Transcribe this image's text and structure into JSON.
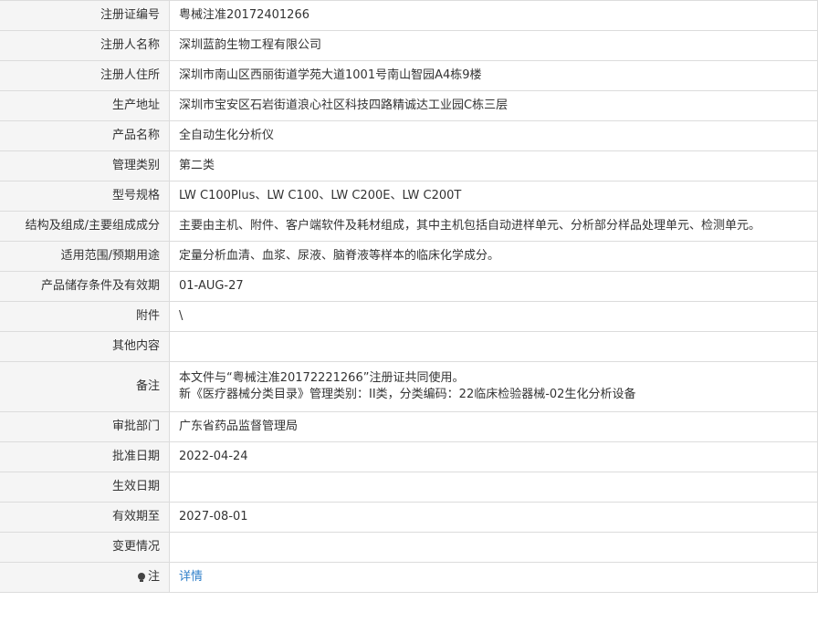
{
  "rows": [
    {
      "label": "注册证编号",
      "value": "粤械注准20172401266"
    },
    {
      "label": "注册人名称",
      "value": "深圳蓝韵生物工程有限公司"
    },
    {
      "label": "注册人住所",
      "value": "深圳市南山区西丽街道学苑大道1001号南山智园A4栋9楼"
    },
    {
      "label": "生产地址",
      "value": "深圳市宝安区石岩街道浪心社区科技四路精诚达工业园C栋三层"
    },
    {
      "label": "产品名称",
      "value": "全自动生化分析仪"
    },
    {
      "label": "管理类别",
      "value": "第二类"
    },
    {
      "label": "型号规格",
      "value": "LW C100Plus、LW C100、LW C200E、LW C200T"
    },
    {
      "label": "结构及组成/主要组成成分",
      "value": "主要由主机、附件、客户端软件及耗材组成，其中主机包括自动进样单元、分析部分样品处理单元、检测单元。"
    },
    {
      "label": "适用范围/预期用途",
      "value": "定量分析血清、血浆、尿液、脑脊液等样本的临床化学成分。"
    },
    {
      "label": "产品储存条件及有效期",
      "value": "01-AUG-27"
    },
    {
      "label": "附件",
      "value": "\\"
    },
    {
      "label": "其他内容",
      "value": ""
    }
  ],
  "remarks": {
    "label": "备注",
    "line1": "本文件与“粤械注准20172221266”注册证共同使用。",
    "line2": "新《医疗器械分类目录》管理类别：II类，分类编码：22临床检验器械-02生化分析设备"
  },
  "rows_after": [
    {
      "label": "审批部门",
      "value": "广东省药品监督管理局"
    },
    {
      "label": "批准日期",
      "value": "2022-04-24"
    },
    {
      "label": "生效日期",
      "value": ""
    },
    {
      "label": "有效期至",
      "value": "2027-08-01"
    },
    {
      "label": "变更情况",
      "value": ""
    }
  ],
  "note": {
    "label": "注",
    "icon": "lightbulb-icon",
    "link_text": "详情"
  }
}
